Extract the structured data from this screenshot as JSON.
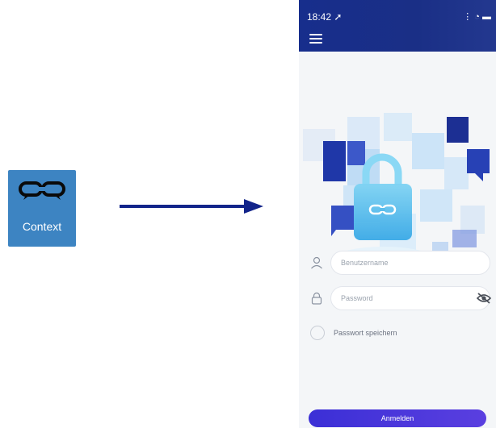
{
  "app_icon": {
    "label": "Context",
    "color": "#3d84c2"
  },
  "arrow": {
    "color": "#12248a"
  },
  "status_bar": {
    "time": "18:42",
    "location_glyph": "➚",
    "icons": "⋮ ◔ ▬"
  },
  "header": {
    "menu_icon": "hamburger-icon"
  },
  "login": {
    "username_placeholder": "Benutzername",
    "password_placeholder": "Password",
    "remember_label": "Passwort speichern",
    "submit_label": "Anmelden"
  },
  "colors": {
    "header": "#172e8c",
    "button": "#4a37dc",
    "accent": "#2a3fa8"
  }
}
